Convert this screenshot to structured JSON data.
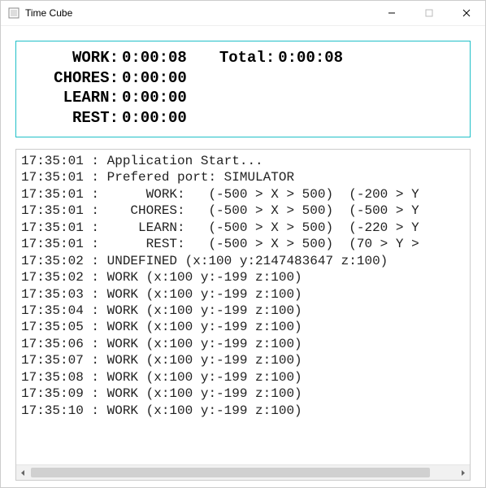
{
  "window": {
    "title": "Time Cube"
  },
  "summary": {
    "rows": [
      {
        "label": "WORK:",
        "value": "0:00:08"
      },
      {
        "label": "CHORES:",
        "value": "0:00:00"
      },
      {
        "label": "LEARN:",
        "value": "0:00:00"
      },
      {
        "label": "REST:",
        "value": "0:00:00"
      }
    ],
    "total_label": "Total:",
    "total_value": "0:00:08"
  },
  "log": {
    "lines": [
      "17:35:01 : Application Start...",
      "17:35:01 : Prefered port: SIMULATOR",
      "17:35:01 :      WORK:   (-500 > X > 500)  (-200 > Y",
      "17:35:01 :    CHORES:   (-500 > X > 500)  (-500 > Y",
      "17:35:01 :     LEARN:   (-500 > X > 500)  (-220 > Y",
      "17:35:01 :      REST:   (-500 > X > 500)  (70 > Y >",
      "17:35:02 : UNDEFINED (x:100 y:2147483647 z:100)",
      "17:35:02 : WORK (x:100 y:-199 z:100)",
      "17:35:03 : WORK (x:100 y:-199 z:100)",
      "17:35:04 : WORK (x:100 y:-199 z:100)",
      "17:35:05 : WORK (x:100 y:-199 z:100)",
      "17:35:06 : WORK (x:100 y:-199 z:100)",
      "17:35:07 : WORK (x:100 y:-199 z:100)",
      "17:35:08 : WORK (x:100 y:-199 z:100)",
      "17:35:09 : WORK (x:100 y:-199 z:100)",
      "17:35:10 : WORK (x:100 y:-199 z:100)"
    ]
  }
}
